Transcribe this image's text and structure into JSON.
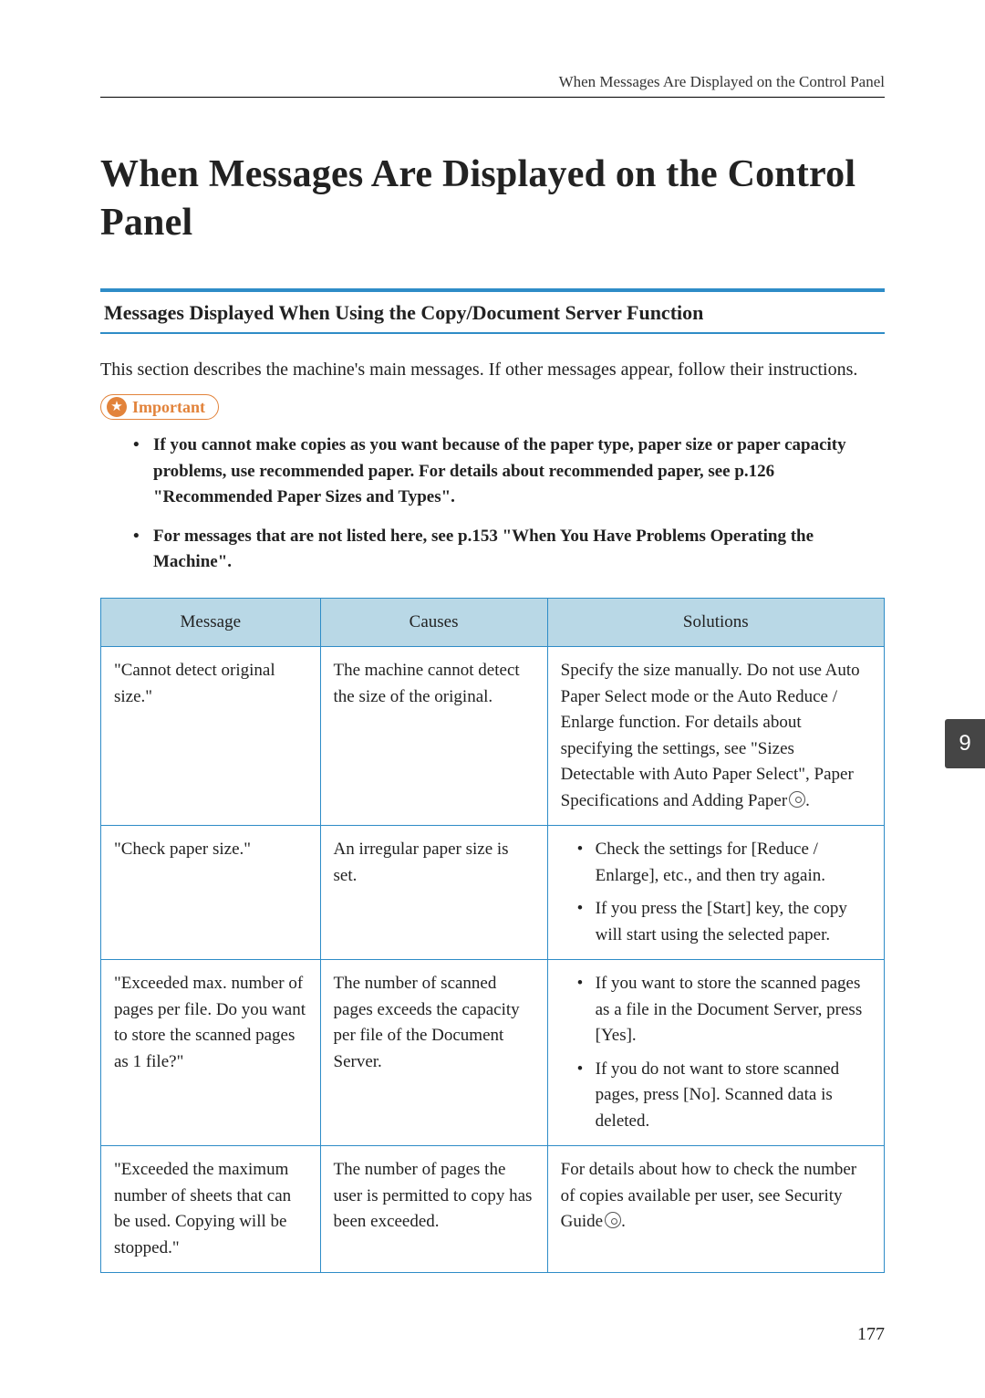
{
  "running_head": "When Messages Are Displayed on the Control Panel",
  "page_title": "When Messages Are Displayed on the Control Panel",
  "section_heading": "Messages Displayed When Using the Copy/Document Server Function",
  "intro": "This section describes the machine's main messages. If other messages appear, follow their instructions.",
  "important_label": "Important",
  "important_items": [
    "If you cannot make copies as you want because of the paper type, paper size or paper capacity problems, use recommended paper. For details about recommended paper, see p.126 \"Recommended Paper Sizes and Types\".",
    "For messages that are not listed here, see p.153 \"When You Have Problems Operating the Machine\"."
  ],
  "table": {
    "headers": {
      "message": "Message",
      "causes": "Causes",
      "solutions": "Solutions"
    },
    "rows": [
      {
        "message": "\"Cannot detect original size.\"",
        "causes": "The machine cannot detect the size of the original.",
        "solutions_text": "Specify the size manually. Do not use Auto Paper Select mode or the Auto Reduce / Enlarge function. For details about specifying the settings, see \"Sizes Detectable with Auto Paper Select\", Paper Specifications and Adding Paper",
        "solutions_has_ref": true
      },
      {
        "message": "\"Check paper size.\"",
        "causes": "An irregular paper size is set.",
        "solutions_list": [
          "Check the settings for [Reduce / Enlarge], etc., and then try again.",
          "If you press the [Start] key, the copy will start using the selected paper."
        ]
      },
      {
        "message": "\"Exceeded max. number of pages per file. Do you want to store the scanned pages as 1 file?\"",
        "causes": "The number of scanned pages exceeds the capacity per file of the Document Server.",
        "solutions_list": [
          "If you want to store the scanned pages as a file in the Document Server, press [Yes].",
          "If you do not want to store scanned pages, press [No]. Scanned data is deleted."
        ]
      },
      {
        "message": "\"Exceeded the maximum number of sheets that can be used. Copying will be stopped.\"",
        "causes": "The number of pages the user is permitted to copy has been exceeded.",
        "solutions_text": "For details about how to check the number of copies available per user, see Security Guide",
        "solutions_has_ref": true
      }
    ]
  },
  "side_tab": "9",
  "page_number": "177"
}
